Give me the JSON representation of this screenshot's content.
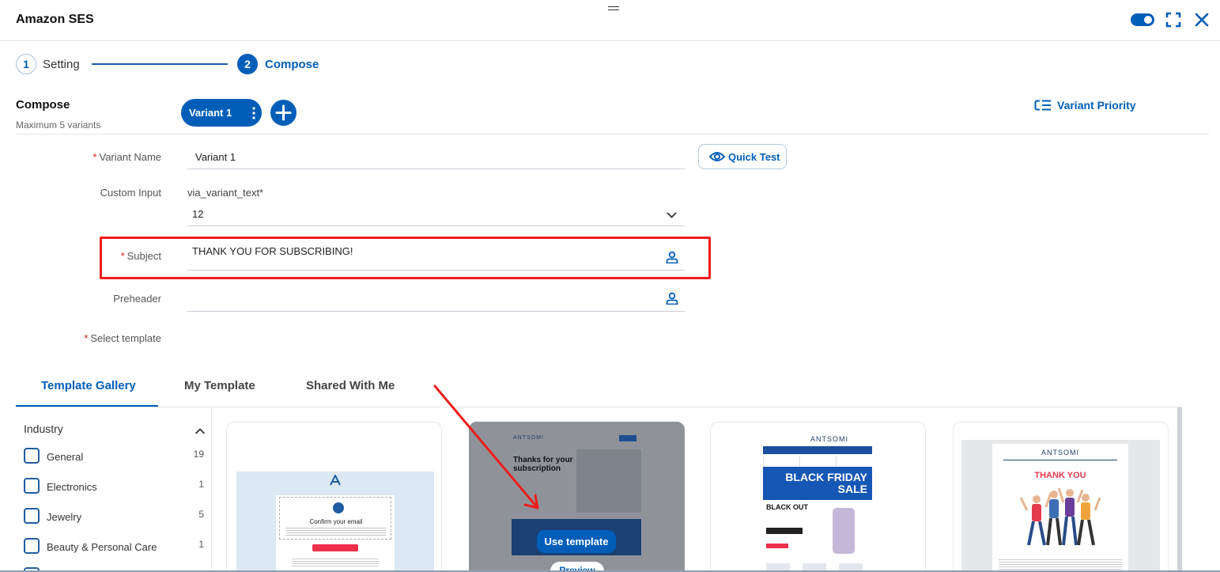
{
  "window": {
    "title": "Amazon SES"
  },
  "stepper": {
    "steps": [
      {
        "number": "1",
        "label": "Setting"
      },
      {
        "number": "2",
        "label": "Compose"
      }
    ]
  },
  "compose": {
    "title": "Compose",
    "subtitle": "Maximum 5 variants",
    "variant_tab_label": "Variant 1",
    "variant_priority_label": "Variant Priority"
  },
  "form": {
    "variant_name": {
      "label": "Variant Name",
      "value": "Variant 1",
      "required": true
    },
    "quick_test_label": "Quick Test",
    "custom_input": {
      "label": "Custom Input",
      "caption": "via_variant_text*",
      "value": "12"
    },
    "subject": {
      "label": "Subject",
      "value": "THANK YOU FOR SUBSCRIBING!",
      "required": true
    },
    "preheader": {
      "label": "Preheader",
      "value": ""
    },
    "select_template": {
      "label": "Select template",
      "required": true
    }
  },
  "required_marker": "*",
  "template_tabs": [
    {
      "label": "Template Gallery",
      "active": true
    },
    {
      "label": "My Template",
      "active": false
    },
    {
      "label": "Shared With Me",
      "active": false
    }
  ],
  "filters": {
    "title": "Industry",
    "items": [
      {
        "label": "General",
        "count": "19"
      },
      {
        "label": "Electronics",
        "count": "1"
      },
      {
        "label": "Jewelry",
        "count": "5"
      },
      {
        "label": "Beauty & Personal Care",
        "count": "1"
      }
    ]
  },
  "templates": {
    "confirm": {
      "title": "Confirm your email"
    },
    "subscription": {
      "logo": "ANTSOMI",
      "headline": "Thanks for your subscription",
      "use_template_label": "Use template",
      "preview_label": "Preview"
    },
    "black_friday": {
      "logo": "ANTSOMI",
      "hero": "BLACK FRIDAY SALE",
      "promo": "BLACK OUT"
    },
    "thank_you": {
      "logo": "ANTSOMI",
      "title": "THANK YOU"
    }
  },
  "colors": {
    "primary": "#005eb8",
    "highlight": "#ee1c1c",
    "required": "#e02020"
  }
}
